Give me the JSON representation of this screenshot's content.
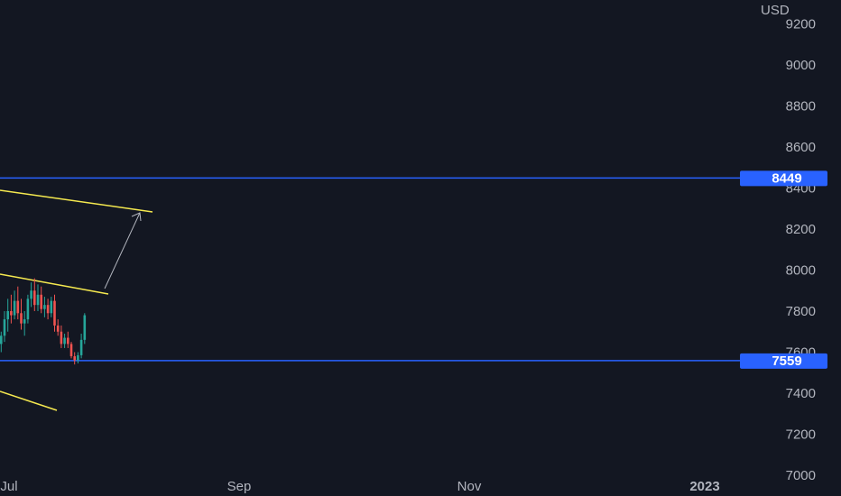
{
  "chart_data": {
    "type": "candlestick",
    "currency_label": "USD",
    "y_ticks": [
      7000,
      7200,
      7400,
      7600,
      7800,
      8000,
      8200,
      8400,
      8600,
      8800,
      9000,
      9200
    ],
    "x_ticks": [
      "Jul",
      "Sep",
      "Nov",
      "2023"
    ],
    "ylim": [
      7000,
      9220
    ],
    "grid": false,
    "price_levels": [
      {
        "value": 8449,
        "label": "8449",
        "color": "#2962ff"
      },
      {
        "value": 7559,
        "label": "7559",
        "color": "#2962ff"
      }
    ],
    "colors": {
      "background": "#131722",
      "up": "#26a69a",
      "down": "#ef5350",
      "trendline": "#f5e94f",
      "arrow": "#b2b5be",
      "axis_text": "#b2b5be"
    },
    "candles": [
      {
        "o": 7640,
        "h": 7700,
        "l": 7600,
        "c": 7680
      },
      {
        "o": 7680,
        "h": 7800,
        "l": 7650,
        "c": 7760
      },
      {
        "o": 7760,
        "h": 7860,
        "l": 7700,
        "c": 7800
      },
      {
        "o": 7800,
        "h": 7880,
        "l": 7740,
        "c": 7780
      },
      {
        "o": 7780,
        "h": 7900,
        "l": 7760,
        "c": 7850
      },
      {
        "o": 7850,
        "h": 7920,
        "l": 7760,
        "c": 7790
      },
      {
        "o": 7790,
        "h": 7860,
        "l": 7710,
        "c": 7740
      },
      {
        "o": 7740,
        "h": 7800,
        "l": 7680,
        "c": 7760
      },
      {
        "o": 7760,
        "h": 7880,
        "l": 7740,
        "c": 7860
      },
      {
        "o": 7860,
        "h": 7940,
        "l": 7820,
        "c": 7900
      },
      {
        "o": 7900,
        "h": 7960,
        "l": 7800,
        "c": 7830
      },
      {
        "o": 7830,
        "h": 7930,
        "l": 7800,
        "c": 7880
      },
      {
        "o": 7880,
        "h": 7920,
        "l": 7790,
        "c": 7810
      },
      {
        "o": 7810,
        "h": 7870,
        "l": 7770,
        "c": 7830
      },
      {
        "o": 7830,
        "h": 7860,
        "l": 7760,
        "c": 7790
      },
      {
        "o": 7790,
        "h": 7870,
        "l": 7770,
        "c": 7850
      },
      {
        "o": 7850,
        "h": 7880,
        "l": 7700,
        "c": 7730
      },
      {
        "o": 7730,
        "h": 7760,
        "l": 7680,
        "c": 7700
      },
      {
        "o": 7700,
        "h": 7730,
        "l": 7620,
        "c": 7640
      },
      {
        "o": 7640,
        "h": 7690,
        "l": 7620,
        "c": 7670
      },
      {
        "o": 7670,
        "h": 7700,
        "l": 7620,
        "c": 7640
      },
      {
        "o": 7640,
        "h": 7650,
        "l": 7570,
        "c": 7580
      },
      {
        "o": 7580,
        "h": 7600,
        "l": 7540,
        "c": 7560
      },
      {
        "o": 7560,
        "h": 7600,
        "l": 7545,
        "c": 7585
      },
      {
        "o": 7585,
        "h": 7690,
        "l": 7570,
        "c": 7660
      },
      {
        "o": 7660,
        "h": 7790,
        "l": 7640,
        "c": 7780
      }
    ]
  }
}
